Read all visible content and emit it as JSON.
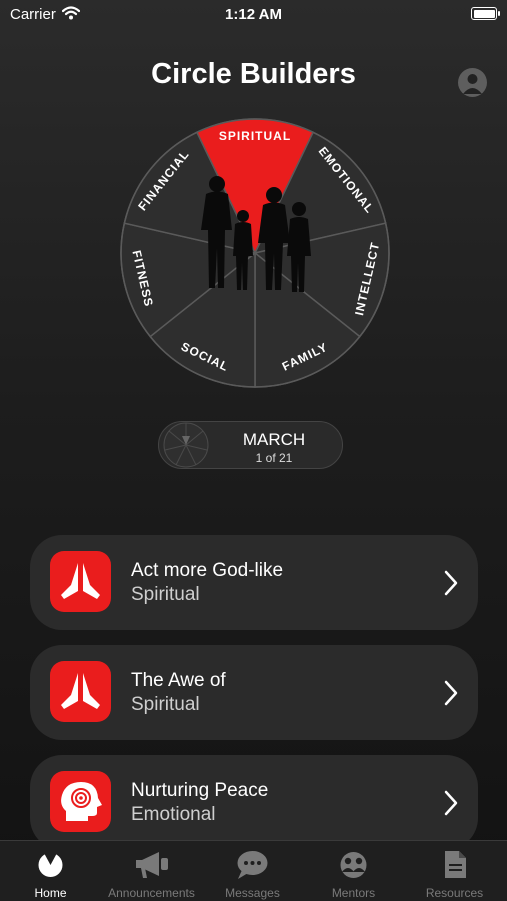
{
  "status_bar": {
    "carrier": "Carrier",
    "time": "1:12 AM"
  },
  "header": {
    "title": "Circle Builders"
  },
  "wheel": {
    "active_color": "#ea1d1d",
    "segments": [
      {
        "label": "SPIRITUAL",
        "active": true
      },
      {
        "label": "EMOTIONAL",
        "active": false
      },
      {
        "label": "INTELLECT",
        "active": false
      },
      {
        "label": "FAMILY",
        "active": false
      },
      {
        "label": "SOCIAL",
        "active": false
      },
      {
        "label": "FITNESS",
        "active": false
      },
      {
        "label": "FINANCIAL",
        "active": false
      }
    ]
  },
  "month_selector": {
    "month": "MARCH",
    "count": "1 of 21"
  },
  "cards": [
    {
      "title": "Act more God-like",
      "subtitle": "Spiritual",
      "icon": "praying-hands-icon"
    },
    {
      "title": "The Awe of",
      "subtitle": "Spiritual",
      "icon": "praying-hands-icon"
    },
    {
      "title": "Nurturing Peace",
      "subtitle": "Emotional",
      "icon": "head-mind-icon"
    }
  ],
  "tabs": [
    {
      "label": "Home",
      "icon": "home-wheel-icon",
      "active": true
    },
    {
      "label": "Announcements",
      "icon": "megaphone-icon",
      "active": false
    },
    {
      "label": "Messages",
      "icon": "chat-bubble-icon",
      "active": false
    },
    {
      "label": "Mentors",
      "icon": "mentors-icon",
      "active": false
    },
    {
      "label": "Resources",
      "icon": "document-icon",
      "active": false
    }
  ]
}
